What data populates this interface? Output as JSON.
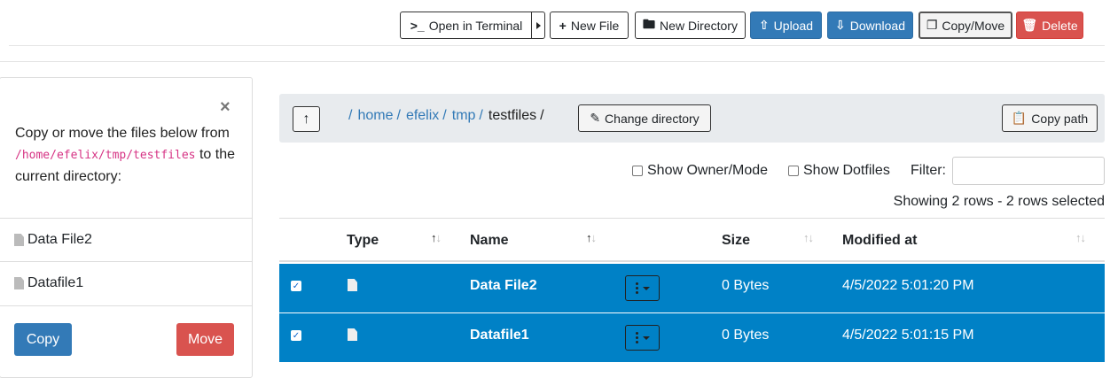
{
  "toolbar": {
    "open_terminal": "Open in Terminal",
    "new_file": "New File",
    "new_directory": "New Directory",
    "upload": "Upload",
    "download": "Download",
    "copy_move": "Copy/Move",
    "delete": "Delete"
  },
  "copy_panel": {
    "close": "×",
    "text_before": "Copy or move the files below from",
    "source_path": "/home/efelix/tmp/testfiles",
    "text_to": "to",
    "text_after": "the current directory:",
    "files": [
      "Data File2",
      "Datafile1"
    ],
    "copy_label": "Copy",
    "move_label": "Move"
  },
  "breadcrumb": {
    "separator": "/",
    "links": [
      "home",
      "efelix",
      "tmp"
    ],
    "current": "testfiles",
    "change_directory": "Change directory",
    "copy_path": "Copy path"
  },
  "options": {
    "show_owner_mode": "Show Owner/Mode",
    "show_dotfiles": "Show Dotfiles",
    "filter_label": "Filter:",
    "filter_value": "",
    "row_info": "Showing 2 rows - 2 rows selected"
  },
  "table": {
    "columns": [
      "Type",
      "Name",
      "Size",
      "Modified at"
    ],
    "rows": [
      {
        "name": "Data File2",
        "size": "0 Bytes",
        "modified": "4/5/2022 5:01:20 PM",
        "selected": true
      },
      {
        "name": "Datafile1",
        "size": "0 Bytes",
        "modified": "4/5/2022 5:01:15 PM",
        "selected": true
      }
    ]
  },
  "colors": {
    "primary": "#337ab7",
    "danger": "#d9534f",
    "selected_row": "#0081c6",
    "path_code": "#d63384"
  }
}
